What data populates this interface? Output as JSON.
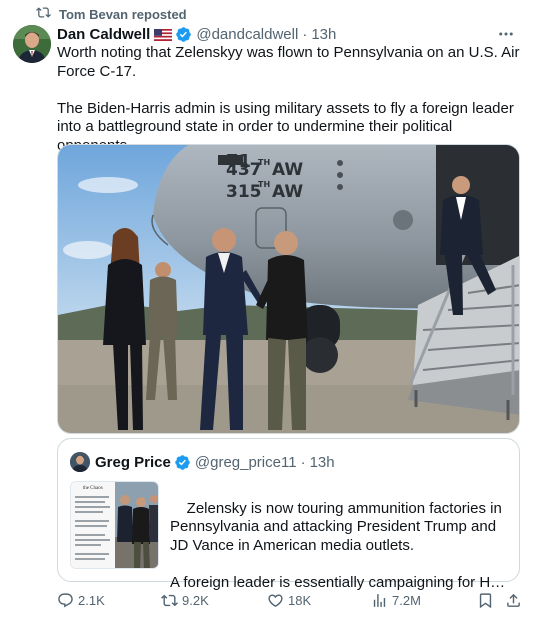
{
  "repost": {
    "label": "Tom Bevan reposted",
    "icon": "repost-icon"
  },
  "post": {
    "author_name": "Dan Caldwell",
    "flag": "us-flag-emoji",
    "handle": "@dandcaldwell",
    "separator": "·",
    "time": "13h",
    "text": "Worth noting that Zelenskyy was flown to Pennsylvania on an U.S. Air Force C-17.\n\nThe Biden-Harris admin is using military assets to fly a foreign leader into a battleground state in order to undermine their political opponents.",
    "media_description": "Photo: aircraft side with markings",
    "aircraft_markings": [
      "437TH AW",
      "315TH AW"
    ]
  },
  "quote": {
    "author_name": "Greg Price",
    "handle": "@greg_price11",
    "separator": "·",
    "time": "13h",
    "text_lines": [
      "Zelensky is now touring ammunition factories in Pennsylvania and attacking President Trump and JD Vance in American media outlets.",
      "A foreign leader is essentially campaigning for Harris ..."
    ],
    "doc_title": "the Chaos"
  },
  "actions": {
    "replies": "2.1K",
    "reposts": "9.2K",
    "likes": "18K",
    "views": "7.2M"
  },
  "colors": {
    "accent": "#1d9bf0",
    "muted": "#536471",
    "border": "#cfd9de",
    "text": "#0f1419"
  }
}
